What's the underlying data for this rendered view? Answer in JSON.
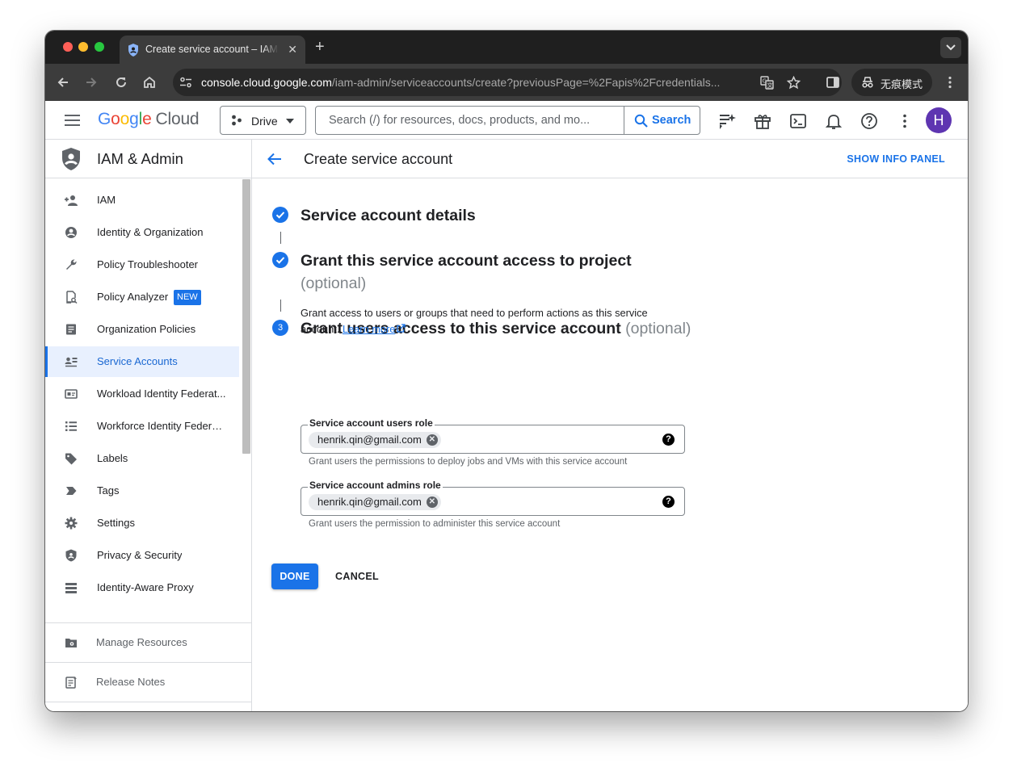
{
  "browser": {
    "tab_title": "Create service account – IAM & Admin",
    "url_host": "console.cloud.google.com",
    "url_path": "/iam-admin/serviceaccounts/create?previousPage=%2Fapis%2Fcredentials...",
    "incognito_label": "无痕模式"
  },
  "header": {
    "logo_google": [
      "G",
      "o",
      "o",
      "g",
      "l",
      "e"
    ],
    "logo_cloud": "Cloud",
    "project": "Drive",
    "search_placeholder": "Search (/) for resources, docs, products, and mo...",
    "search_button": "Search",
    "avatar_letter": "H"
  },
  "sidebar": {
    "title": "IAM & Admin",
    "items": [
      {
        "label": "IAM",
        "icon": "person-add-icon"
      },
      {
        "label": "Identity & Organization",
        "icon": "account-circle-icon"
      },
      {
        "label": "Policy Troubleshooter",
        "icon": "wrench-icon"
      },
      {
        "label": "Policy Analyzer",
        "icon": "policy-analyzer-icon",
        "badge": "NEW"
      },
      {
        "label": "Organization Policies",
        "icon": "document-icon"
      },
      {
        "label": "Service Accounts",
        "icon": "service-account-icon",
        "active": true
      },
      {
        "label": "Workload Identity Federat...",
        "icon": "id-card-icon"
      },
      {
        "label": "Workforce Identity Federa...",
        "icon": "list-icon"
      },
      {
        "label": "Labels",
        "icon": "label-icon"
      },
      {
        "label": "Tags",
        "icon": "tag-icon"
      },
      {
        "label": "Settings",
        "icon": "gear-icon"
      },
      {
        "label": "Privacy & Security",
        "icon": "shield-icon"
      },
      {
        "label": "Identity-Aware Proxy",
        "icon": "proxy-icon"
      }
    ],
    "footer": [
      {
        "label": "Manage Resources",
        "icon": "folder-gear-icon"
      },
      {
        "label": "Release Notes",
        "icon": "notes-icon"
      }
    ],
    "collapse_label": "<|"
  },
  "main": {
    "title": "Create service account",
    "info_panel": "SHOW INFO PANEL",
    "steps": [
      {
        "title": "Service account details",
        "optional": ""
      },
      {
        "title": "Grant this service account access to project",
        "optional": "(optional)"
      },
      {
        "title": "Grant users access to this service account",
        "optional": "(optional)",
        "number": "3"
      }
    ],
    "step3_description": "Grant access to users or groups that need to perform actions as this service account.",
    "learn_more": "Learn more",
    "users_role": {
      "label": "Service account users role",
      "chip": "henrik.qin@gmail.com",
      "hint": "Grant users the permissions to deploy jobs and VMs with this service account"
    },
    "admins_role": {
      "label": "Service account admins role",
      "chip": "henrik.qin@gmail.com",
      "hint": "Grant users the permission to administer this service account"
    },
    "done_button": "DONE",
    "cancel_button": "CANCEL"
  },
  "colors": {
    "accent": "#1a73e8",
    "avatar": "#5e35b1"
  }
}
